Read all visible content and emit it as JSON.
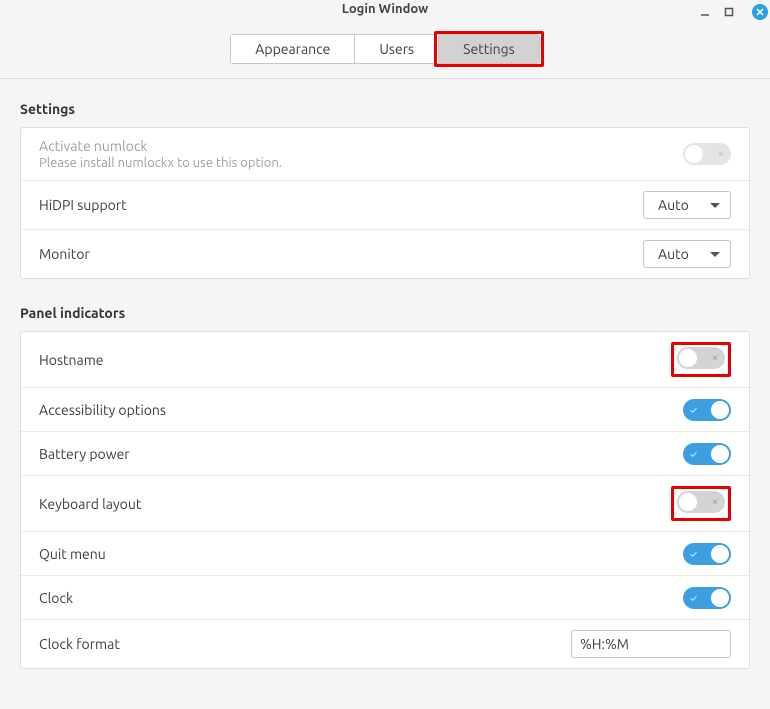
{
  "window": {
    "title": "Login Window"
  },
  "tabs": {
    "appearance": "Appearance",
    "users": "Users",
    "settings": "Settings"
  },
  "sections": {
    "settings": "Settings",
    "panel_indicators": "Panel indicators"
  },
  "settings_rows": {
    "numlock_label": "Activate numlock",
    "numlock_hint": "Please install numlockx to use this option.",
    "hidpi_label": "HiDPI support",
    "hidpi_value": "Auto",
    "monitor_label": "Monitor",
    "monitor_value": "Auto"
  },
  "indicators": {
    "hostname": "Hostname",
    "accessibility": "Accessibility options",
    "battery": "Battery power",
    "keyboard": "Keyboard layout",
    "quit": "Quit menu",
    "clock": "Clock",
    "clock_format_label": "Clock format",
    "clock_format_value": "%H:%M"
  },
  "toggle_states": {
    "numlock": false,
    "hostname": false,
    "accessibility": true,
    "battery": true,
    "keyboard": false,
    "quit": true,
    "clock": true
  }
}
